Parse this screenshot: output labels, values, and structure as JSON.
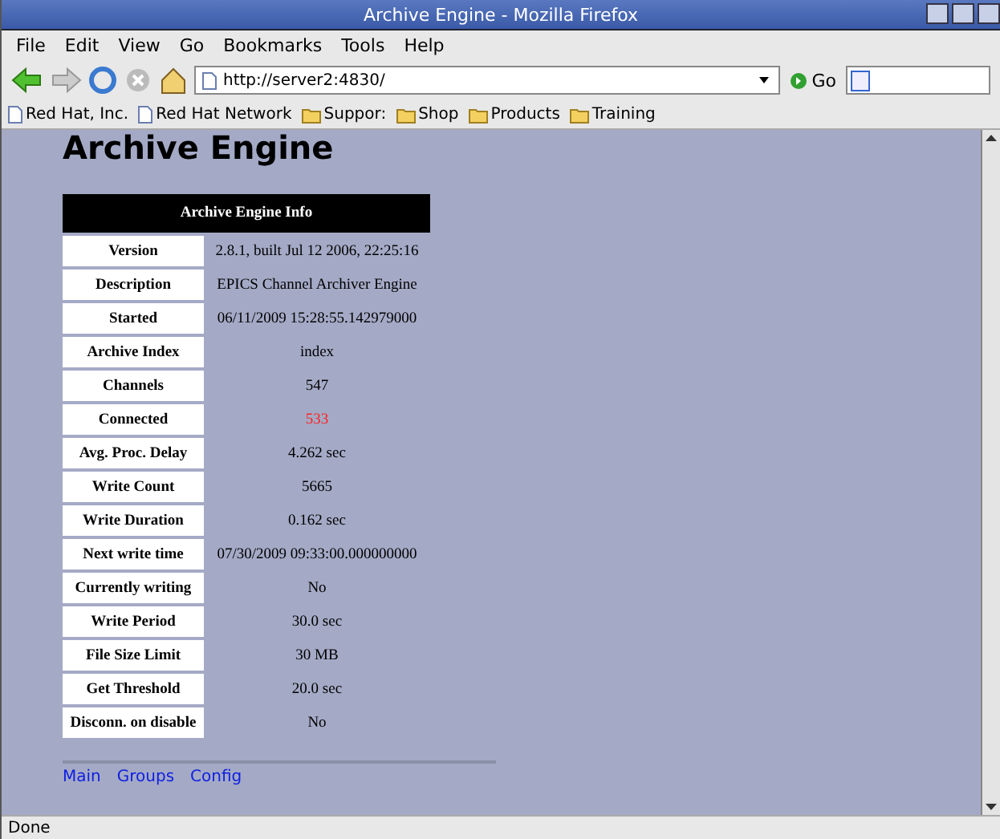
{
  "window": {
    "title": "Archive Engine - Mozilla Firefox"
  },
  "menu": [
    "File",
    "Edit",
    "View",
    "Go",
    "Bookmarks",
    "Tools",
    "Help"
  ],
  "address": {
    "value": "http://server2:4830/",
    "go": "Go"
  },
  "bookmarks": [
    {
      "kind": "page",
      "label": "Red Hat, Inc."
    },
    {
      "kind": "page",
      "label": "Red Hat Network"
    },
    {
      "kind": "folder",
      "label": "Suppor:"
    },
    {
      "kind": "folder",
      "label": "Shop"
    },
    {
      "kind": "folder",
      "label": "Products"
    },
    {
      "kind": "folder",
      "label": "Training"
    }
  ],
  "page": {
    "heading": "Archive Engine",
    "table_title": "Archive Engine Info",
    "rows": [
      {
        "label": "Version",
        "value": "2.8.1, built Jul 12 2006, 22:25:16",
        "color": "#000000"
      },
      {
        "label": "Description",
        "value": "EPICS Channel Archiver Engine",
        "color": "#000000"
      },
      {
        "label": "Started",
        "value": "06/11/2009 15:28:55.142979000",
        "color": "#000000"
      },
      {
        "label": "Archive Index",
        "value": "index",
        "color": "#000000"
      },
      {
        "label": "Channels",
        "value": "547",
        "color": "#000000"
      },
      {
        "label": "Connected",
        "value": "533",
        "color": "#ff2020"
      },
      {
        "label": "Avg. Proc. Delay",
        "value": "4.262 sec",
        "color": "#000000"
      },
      {
        "label": "Write Count",
        "value": "5665",
        "color": "#000000"
      },
      {
        "label": "Write Duration",
        "value": "0.162 sec",
        "color": "#000000"
      },
      {
        "label": "Next write time",
        "value": "07/30/2009 09:33:00.000000000",
        "color": "#000000"
      },
      {
        "label": "Currently writing",
        "value": "No",
        "color": "#000000"
      },
      {
        "label": "Write Period",
        "value": "30.0 sec",
        "color": "#000000"
      },
      {
        "label": "File Size Limit",
        "value": "30 MB",
        "color": "#000000"
      },
      {
        "label": "Get Threshold",
        "value": "20.0 sec",
        "color": "#000000"
      },
      {
        "label": "Disconn. on disable",
        "value": "No",
        "color": "#000000"
      }
    ],
    "links": [
      "Main",
      "Groups",
      "Config"
    ]
  },
  "status_bar": "Done"
}
